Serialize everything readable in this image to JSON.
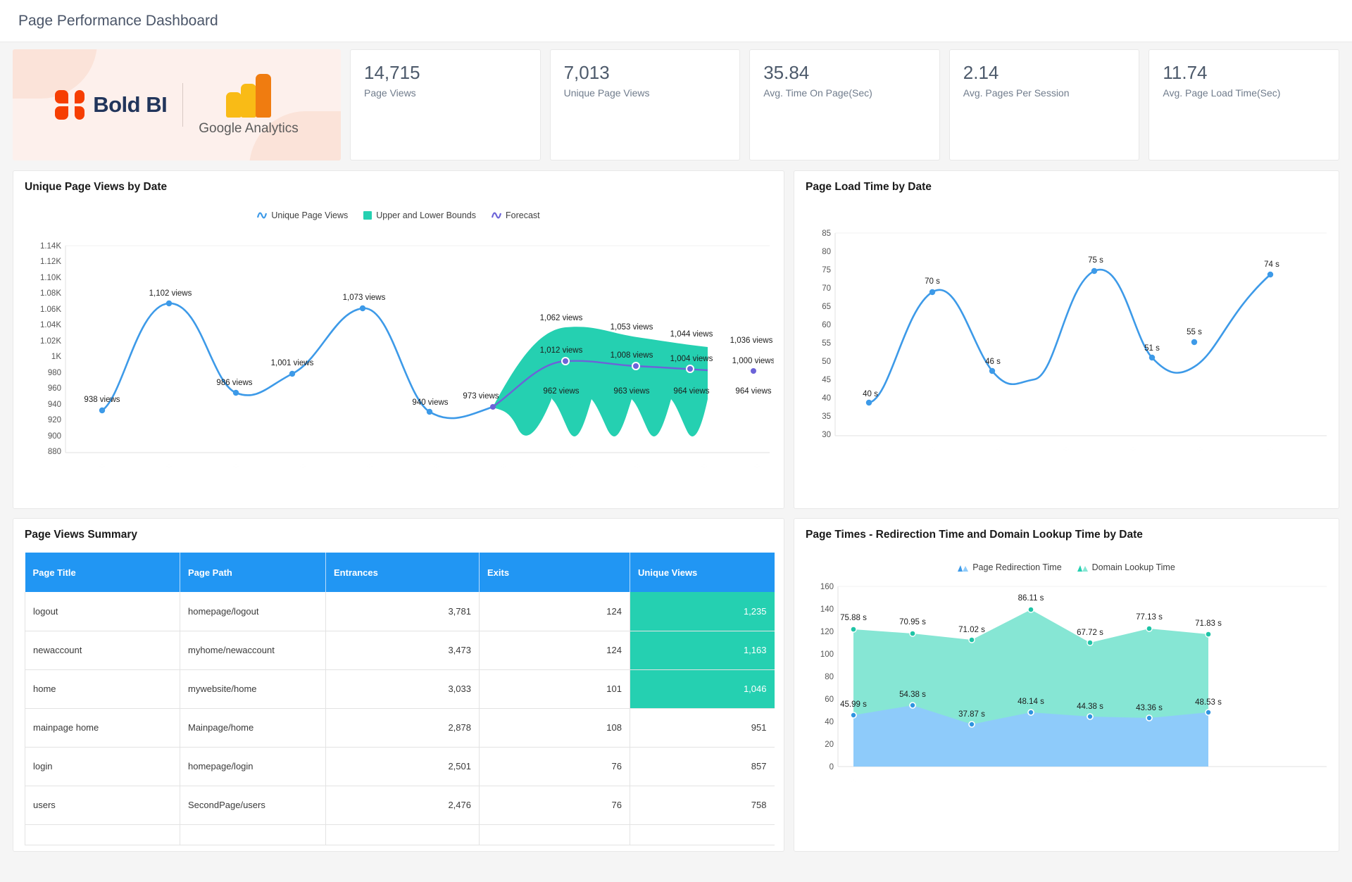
{
  "header": {
    "title": "Page Performance Dashboard"
  },
  "brand": {
    "boldbi": "Bold BI",
    "google_analytics": "Google Analytics"
  },
  "kpis": [
    {
      "value": "14,715",
      "label": "Page Views"
    },
    {
      "value": "7,013",
      "label": "Unique Page Views"
    },
    {
      "value": "35.84",
      "label": "Avg. Time On Page(Sec)"
    },
    {
      "value": "2.14",
      "label": "Avg. Pages Per Session"
    },
    {
      "value": "11.74",
      "label": "Avg. Page Load Time(Sec)"
    }
  ],
  "panels": {
    "unique_views": "Unique Page Views by Date",
    "load_time": "Page Load Time by Date",
    "summary": "Page Views Summary",
    "page_times": "Page Times - Redirection Time and Domain Lookup Time by Date"
  },
  "colors": {
    "series_blue": "#3d9ae8",
    "forecast_purple": "#6c63d8",
    "bounds_teal": "#25d0b1",
    "redirection_blue": "#8ecbfa",
    "lookup_teal": "#86e6d4",
    "header_blue": "#2196f3"
  },
  "table": {
    "columns": [
      "Page Title",
      "Page Path",
      "Entrances",
      "Exits",
      "Unique Views"
    ],
    "rows": [
      {
        "title": "logout",
        "path": "homepage/logout",
        "entrances": "3,781",
        "exits": "124",
        "unique": "1,235",
        "highlight": true
      },
      {
        "title": "newaccount",
        "path": "myhome/newaccount",
        "entrances": "3,473",
        "exits": "124",
        "unique": "1,163",
        "highlight": true
      },
      {
        "title": "home",
        "path": "mywebsite/home",
        "entrances": "3,033",
        "exits": "101",
        "unique": "1,046",
        "highlight": true
      },
      {
        "title": "mainpage home",
        "path": "Mainpage/home",
        "entrances": "2,878",
        "exits": "108",
        "unique": "951",
        "highlight": false
      },
      {
        "title": "login",
        "path": "homepage/login",
        "entrances": "2,501",
        "exits": "76",
        "unique": "857",
        "highlight": false
      },
      {
        "title": "users",
        "path": "SecondPage/users",
        "entrances": "2,476",
        "exits": "76",
        "unique": "758",
        "highlight": false
      },
      {
        "title": "",
        "path": "",
        "entrances": "",
        "exits": "",
        "unique": "",
        "highlight": false
      }
    ]
  },
  "chart_data": [
    {
      "type": "line",
      "title": "Unique Page Views by Date",
      "xlabel": "",
      "ylabel": "",
      "ylim": [
        880,
        1140
      ],
      "yticks": [
        "880",
        "900",
        "920",
        "940",
        "960",
        "980",
        "1K",
        "1.02K",
        "1.04K",
        "1.06K",
        "1.08K",
        "1.10K",
        "1.12K",
        "1.14K"
      ],
      "grid": false,
      "legend": [
        "Unique Page Views",
        "Upper and Lower Bounds",
        "Forecast"
      ],
      "legend_position": "top-center",
      "series": [
        {
          "name": "Unique Page Views",
          "values": [
            938,
            1102,
            986,
            1001,
            1073,
            940,
            973
          ],
          "labels": [
            "938 views",
            "1,102 views",
            "986 views",
            "1,001 views",
            "1,073 views",
            "940 views",
            "973 views"
          ]
        },
        {
          "name": "Forecast",
          "values": [
            973,
            1012,
            1008,
            1004,
            1000
          ],
          "labels": [
            "973 views",
            "1,012 views",
            "1,008 views",
            "1,004 views",
            "1,000 views"
          ]
        },
        {
          "name": "Upper Bound",
          "values": [
            973,
            1062,
            1053,
            1044,
            1036
          ],
          "labels": [
            "1,062 views",
            "1,053 views",
            "1,044 views",
            "1,036 views"
          ]
        },
        {
          "name": "Lower Bound",
          "values": [
            973,
            962,
            963,
            964,
            964
          ],
          "labels": [
            "962 views",
            "963 views",
            "964 views",
            "964 views"
          ]
        }
      ]
    },
    {
      "type": "line",
      "title": "Page Load Time by Date",
      "xlabel": "",
      "ylabel": "",
      "ylim": [
        30,
        85
      ],
      "yticks": [
        "30",
        "35",
        "40",
        "45",
        "50",
        "55",
        "60",
        "65",
        "70",
        "75",
        "80",
        "85"
      ],
      "grid": false,
      "series": [
        {
          "name": "Page Load Time",
          "values": [
            40,
            70,
            46,
            75,
            51,
            55,
            74
          ],
          "labels": [
            "40 s",
            "70 s",
            "46 s",
            "75 s",
            "51 s",
            "55 s",
            "74 s"
          ]
        }
      ]
    },
    {
      "type": "area",
      "title": "Page Times - Redirection Time and Domain Lookup Time by Date",
      "xlabel": "",
      "ylabel": "",
      "ylim": [
        0,
        160
      ],
      "yticks": [
        "0",
        "20",
        "40",
        "60",
        "80",
        "100",
        "120",
        "140",
        "160"
      ],
      "grid": false,
      "legend": [
        "Page Redirection Time",
        "Domain Lookup Time"
      ],
      "legend_position": "top-center",
      "series": [
        {
          "name": "Page Redirection Time",
          "values": [
            45.99,
            54.38,
            37.87,
            48.14,
            44.38,
            43.36,
            48.53
          ],
          "labels": [
            "45.99 s",
            "54.38 s",
            "37.87 s",
            "48.14 s",
            "44.38 s",
            "43.36 s",
            "48.53 s"
          ]
        },
        {
          "name": "Domain Lookup Time",
          "values": [
            75.88,
            70.95,
            71.02,
            86.11,
            67.72,
            77.13,
            71.83
          ],
          "labels": [
            "75.88 s",
            "70.95 s",
            "71.02 s",
            "86.11 s",
            "67.72 s",
            "77.13 s",
            "71.83 s"
          ]
        }
      ]
    }
  ]
}
